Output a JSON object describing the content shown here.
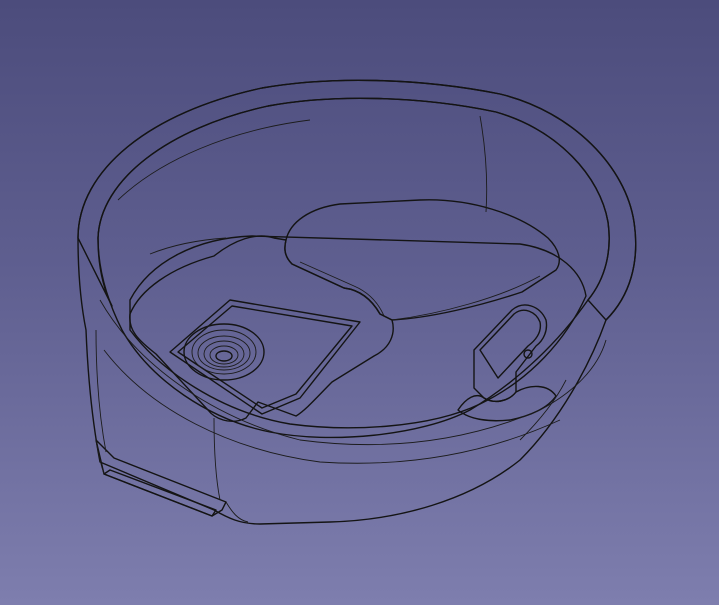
{
  "viewport": {
    "background_top": "#4c4c7c",
    "background_bottom": "#7e7eae"
  },
  "model": {
    "shaded_color": "#b9b9b9",
    "shadow_color": "#6e6e6e",
    "highlight_color": "#dedede",
    "edge_color": "#141414"
  }
}
